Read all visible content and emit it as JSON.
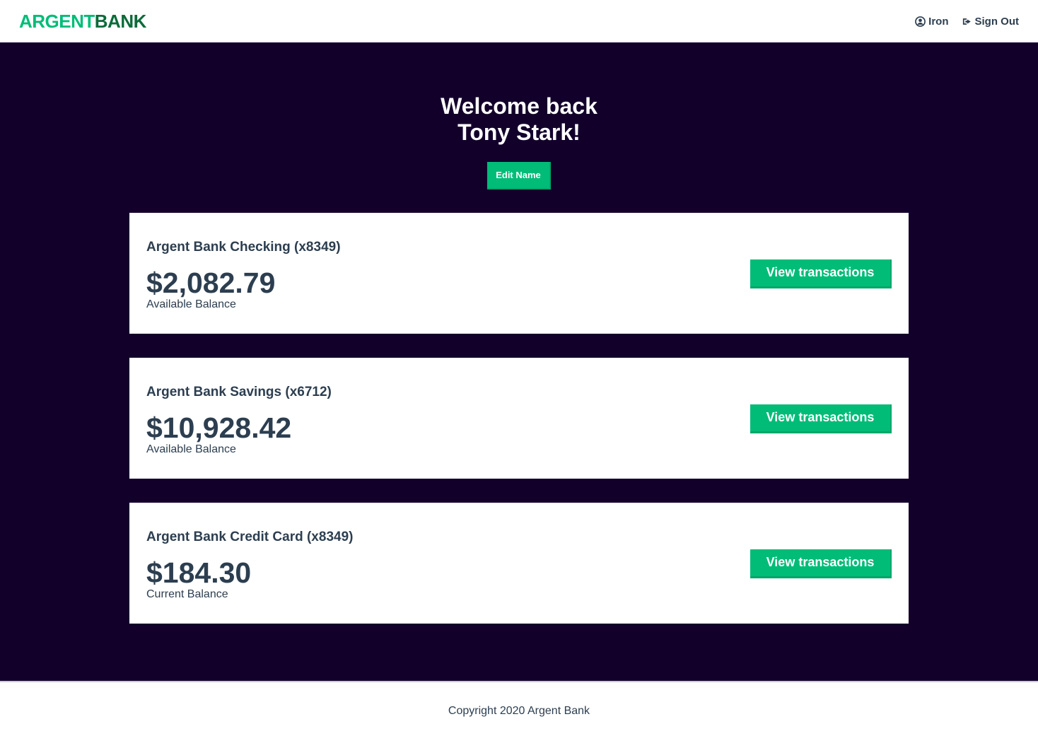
{
  "header": {
    "logo_part1": "ARGENT",
    "logo_part2": "BANK",
    "user_label": "Iron",
    "signout_label": "Sign Out"
  },
  "colors": {
    "accent": "#00bc77",
    "logo_dark": "#0b6b3a",
    "main_bg": "#12002b",
    "text": "#2c3e50"
  },
  "welcome": {
    "line1": "Welcome back",
    "line2": "Tony Stark!",
    "edit_label": "Edit Name"
  },
  "accounts": [
    {
      "title": "Argent Bank Checking (x8349)",
      "amount": "$2,082.79",
      "description": "Available Balance",
      "button_label": "View transactions"
    },
    {
      "title": "Argent Bank Savings (x6712)",
      "amount": "$10,928.42",
      "description": "Available Balance",
      "button_label": "View transactions"
    },
    {
      "title": "Argent Bank Credit Card (x8349)",
      "amount": "$184.30",
      "description": "Current Balance",
      "button_label": "View transactions"
    }
  ],
  "footer": {
    "text": "Copyright 2020 Argent Bank"
  },
  "icons": {
    "user": "user-circle-icon",
    "signout": "sign-out-icon"
  }
}
